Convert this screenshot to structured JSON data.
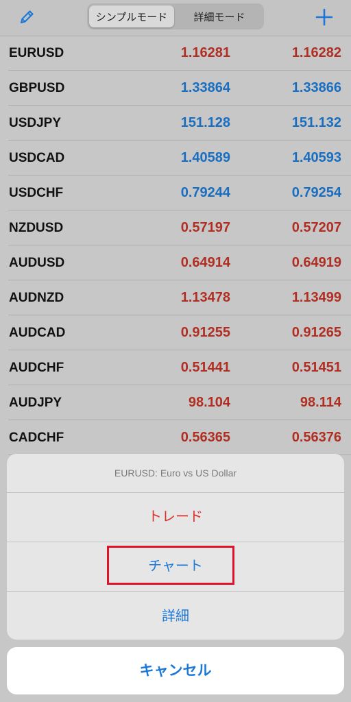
{
  "header": {
    "segments": [
      "シンプルモード",
      "詳細モード"
    ],
    "active_segment": "シンプルモード",
    "icons": {
      "left": "pencil-edit-icon",
      "right": "plus-icon"
    }
  },
  "colors": {
    "up": "#1a6ec0",
    "down": "#b02e22",
    "accent": "#1b78d8",
    "destructive": "#d8322a"
  },
  "quotes": [
    {
      "symbol": "EURUSD",
      "bid": "1.16281",
      "ask": "1.16282",
      "dir": "down"
    },
    {
      "symbol": "GBPUSD",
      "bid": "1.33864",
      "ask": "1.33866",
      "dir": "up"
    },
    {
      "symbol": "USDJPY",
      "bid": "151.128",
      "ask": "151.132",
      "dir": "up"
    },
    {
      "symbol": "USDCAD",
      "bid": "1.40589",
      "ask": "1.40593",
      "dir": "up"
    },
    {
      "symbol": "USDCHF",
      "bid": "0.79244",
      "ask": "0.79254",
      "dir": "up"
    },
    {
      "symbol": "NZDUSD",
      "bid": "0.57197",
      "ask": "0.57207",
      "dir": "down"
    },
    {
      "symbol": "AUDUSD",
      "bid": "0.64914",
      "ask": "0.64919",
      "dir": "down"
    },
    {
      "symbol": "AUDNZD",
      "bid": "1.13478",
      "ask": "1.13499",
      "dir": "down"
    },
    {
      "symbol": "AUDCAD",
      "bid": "0.91255",
      "ask": "0.91265",
      "dir": "down"
    },
    {
      "symbol": "AUDCHF",
      "bid": "0.51441",
      "ask": "0.51451",
      "dir": "down"
    },
    {
      "symbol": "AUDJPY",
      "bid": "98.104",
      "ask": "98.114",
      "dir": "down"
    },
    {
      "symbol": "CADCHF",
      "bid": "0.56365",
      "ask": "0.56376",
      "dir": "down"
    }
  ],
  "action_sheet": {
    "title": "EURUSD: Euro vs US Dollar",
    "trade": "トレード",
    "chart": "チャート",
    "details": "詳細",
    "cancel": "キャンセル"
  }
}
